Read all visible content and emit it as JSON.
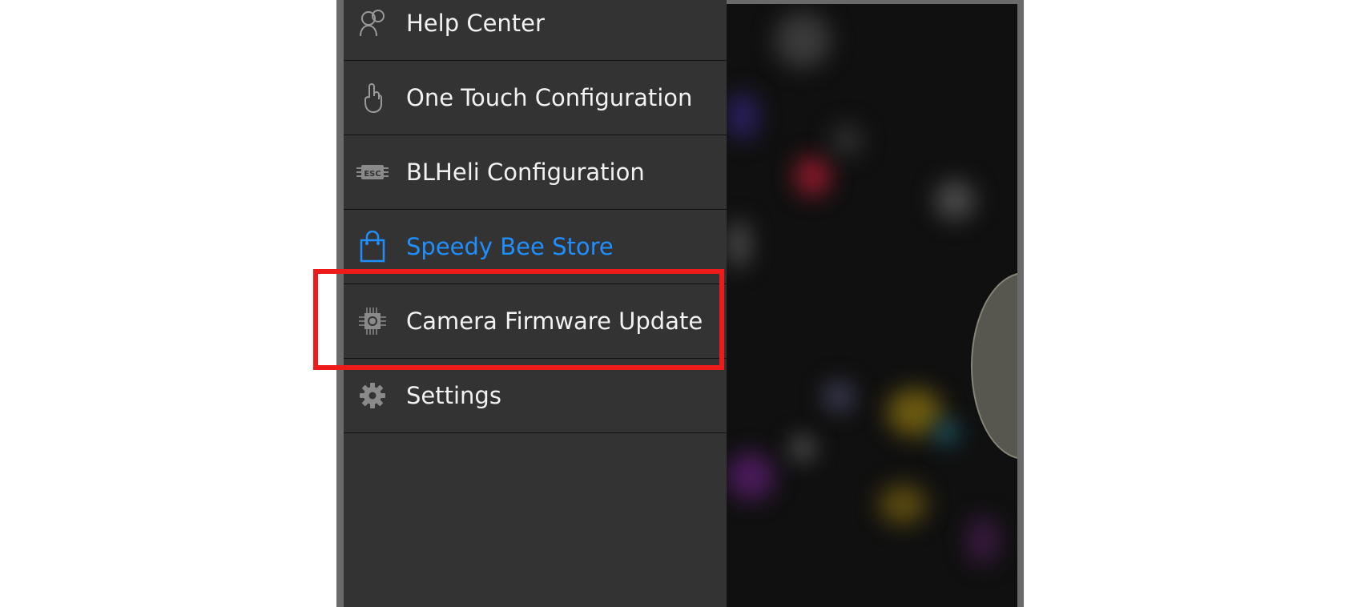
{
  "menu": {
    "items": [
      {
        "label": "Help Center",
        "icon": "help-center-icon"
      },
      {
        "label": "One Touch Configuration",
        "icon": "touch-hand-icon"
      },
      {
        "label": "BLHeli Configuration",
        "icon": "esc-chip-icon"
      },
      {
        "label": "Speedy Bee Store",
        "icon": "shopping-bag-icon"
      },
      {
        "label": "Camera Firmware Update",
        "icon": "firmware-chip-icon"
      },
      {
        "label": "Settings",
        "icon": "gear-icon"
      }
    ],
    "store_color": "#1f8fff",
    "highlight_color": "#ee1b1b"
  }
}
